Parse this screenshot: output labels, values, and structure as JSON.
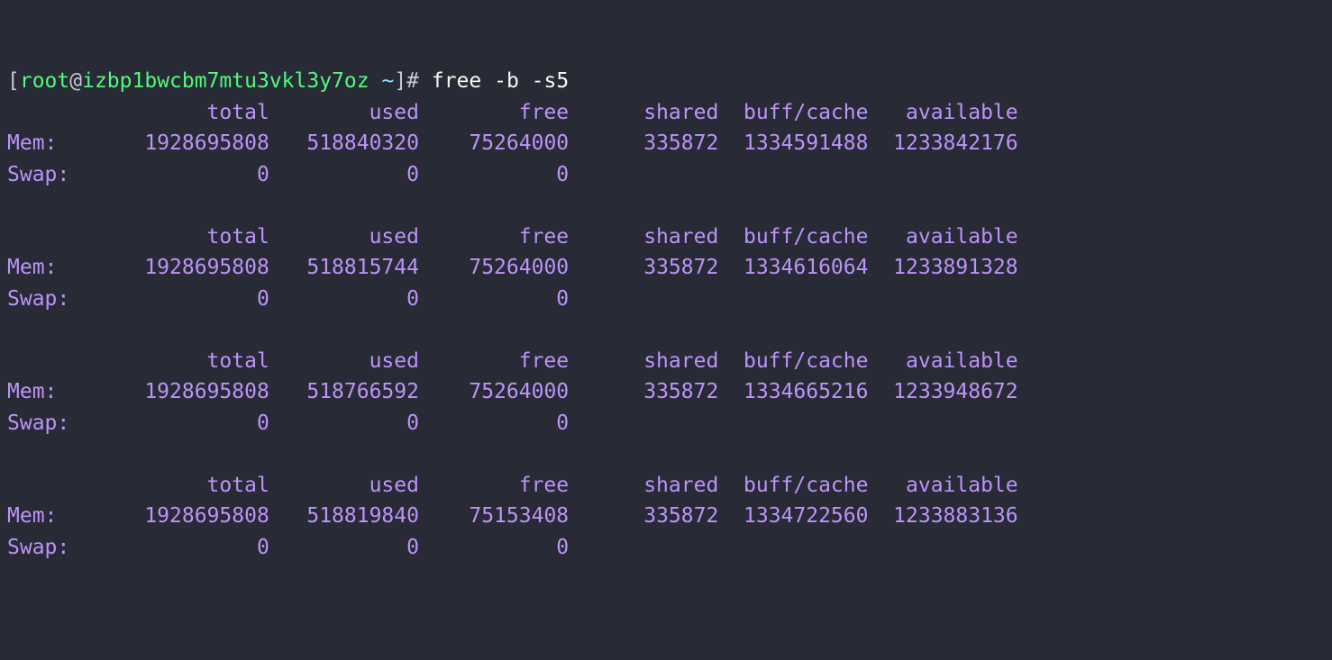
{
  "prompt": {
    "open": "[",
    "user": "root",
    "at": "@",
    "host": "izbp1bwcbm7mtu3vkl3y7oz",
    "path": " ~",
    "close": "]# ",
    "command": "free -b -s5"
  },
  "headers": [
    "total",
    "used",
    "free",
    "shared",
    "buff/cache",
    "available"
  ],
  "labels": {
    "mem": "Mem:",
    "swap": "Swap:"
  },
  "snapshots": [
    {
      "mem": [
        "1928695808",
        "518840320",
        "75264000",
        "335872",
        "1334591488",
        "1233842176"
      ],
      "swap": [
        "0",
        "0",
        "0"
      ]
    },
    {
      "mem": [
        "1928695808",
        "518815744",
        "75264000",
        "335872",
        "1334616064",
        "1233891328"
      ],
      "swap": [
        "0",
        "0",
        "0"
      ]
    },
    {
      "mem": [
        "1928695808",
        "518766592",
        "75264000",
        "335872",
        "1334665216",
        "1233948672"
      ],
      "swap": [
        "0",
        "0",
        "0"
      ]
    },
    {
      "mem": [
        "1928695808",
        "518819840",
        "75153408",
        "335872",
        "1334722560",
        "1233883136"
      ],
      "swap": [
        "0",
        "0",
        "0"
      ]
    }
  ],
  "col_widths": {
    "label": 6,
    "cols": [
      15,
      12,
      12,
      12,
      12,
      12
    ]
  }
}
